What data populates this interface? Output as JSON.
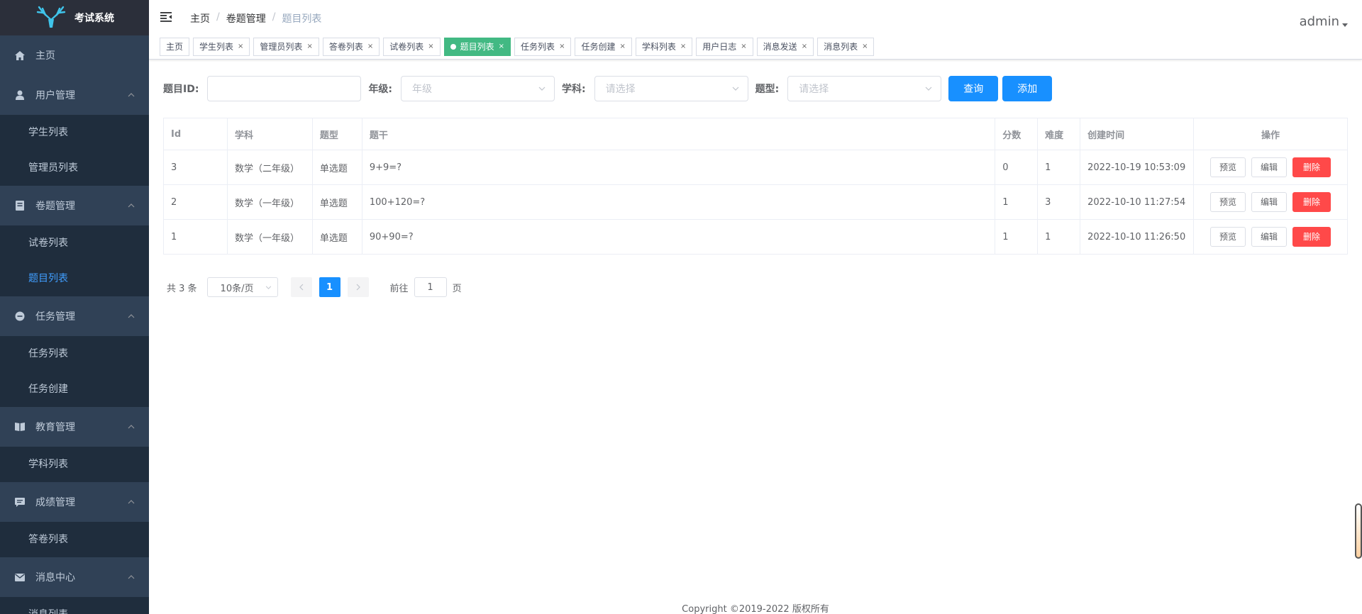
{
  "app": {
    "title": "考试系统"
  },
  "colors": {
    "sidebar_bg": "#304156",
    "active_tag": "#42b983",
    "primary": "#1890ff",
    "danger": "#ff4949",
    "active_menu": "#409eff"
  },
  "sidebar": {
    "home": {
      "label": "主页",
      "icon": "home-icon"
    },
    "groups": [
      {
        "label": "用户管理",
        "icon": "user-icon",
        "items": [
          "学生列表",
          "管理员列表"
        ]
      },
      {
        "label": "卷题管理",
        "icon": "book-icon",
        "items": [
          "试卷列表",
          "题目列表"
        ]
      },
      {
        "label": "任务管理",
        "icon": "task-icon",
        "items": [
          "任务列表",
          "任务创建"
        ]
      },
      {
        "label": "教育管理",
        "icon": "education-icon",
        "items": [
          "学科列表"
        ]
      },
      {
        "label": "成绩管理",
        "icon": "score-icon",
        "items": [
          "答卷列表"
        ]
      },
      {
        "label": "消息中心",
        "icon": "message-icon",
        "items": [
          "消息列表"
        ]
      }
    ]
  },
  "navbar": {
    "breadcrumb": [
      "主页",
      "卷题管理",
      "题目列表"
    ],
    "user": "admin"
  },
  "tags": [
    "主页",
    "学生列表",
    "管理员列表",
    "答卷列表",
    "试卷列表",
    "题目列表",
    "任务列表",
    "任务创建",
    "学科列表",
    "用户日志",
    "消息发送",
    "消息列表"
  ],
  "filter": {
    "id_label": "题目ID:",
    "id_value": "",
    "grade_label": "年级:",
    "grade_placeholder": "年级",
    "subject_label": "学科:",
    "subject_placeholder": "请选择",
    "type_label": "题型:",
    "type_placeholder": "请选择",
    "query": "查询",
    "add": "添加"
  },
  "table": {
    "headers": [
      "Id",
      "学科",
      "题型",
      "题干",
      "分数",
      "难度",
      "创建时间",
      "操作"
    ],
    "rows": [
      {
        "id": "3",
        "subject": "数学（二年级）",
        "type": "单选题",
        "stem": "9+9=?",
        "score": "0",
        "difficulty": "1",
        "created": "2022-10-19 10:53:09"
      },
      {
        "id": "2",
        "subject": "数学（一年级）",
        "type": "单选题",
        "stem": "100+120=?",
        "score": "1",
        "difficulty": "3",
        "created": "2022-10-10 11:27:54"
      },
      {
        "id": "1",
        "subject": "数学（一年级）",
        "type": "单选题",
        "stem": "90+90=?",
        "score": "1",
        "difficulty": "1",
        "created": "2022-10-10 11:26:50"
      }
    ],
    "actions": {
      "preview": "预览",
      "edit": "编辑",
      "delete": "删除"
    }
  },
  "pagination": {
    "total": "共 3 条",
    "page_size": "10条/页",
    "current": "1",
    "goto_prefix": "前往",
    "goto_value": "1",
    "goto_suffix": "页"
  },
  "footer": "Copyright ©2019-2022 版权所有"
}
